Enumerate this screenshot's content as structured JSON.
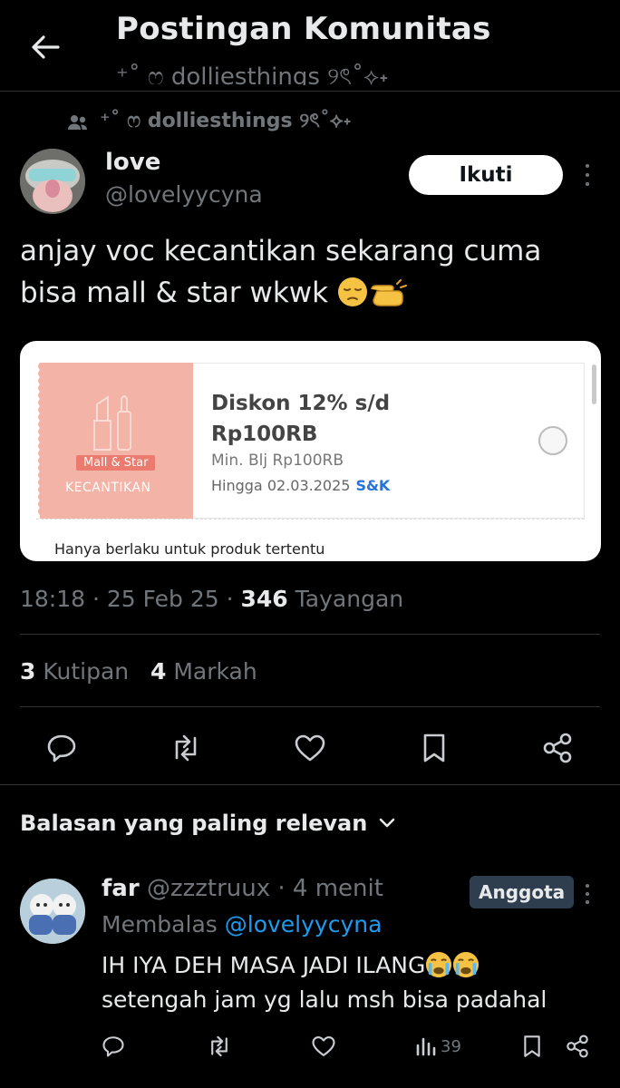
{
  "header": {
    "title": "Postingan Komunitas",
    "subtitle": "⁺˚ ෆ dolliesthings ୨ৎ˚⟡˖"
  },
  "community": {
    "name": "⁺˚ ෆ dolliesthings ୨ৎ˚⟡˖"
  },
  "post": {
    "author_name": "love",
    "author_handle": "@lovelyycyna",
    "follow_label": "Ikuti",
    "text_line1": "anjay voc kecantikan sekarang cuma",
    "text_line2": "bisa mall & star wkwk",
    "voucher": {
      "title_line1": "Diskon 12% s/d",
      "title_line2": "Rp100RB",
      "min_purchase": "Min. Blj Rp100RB",
      "valid_until": "Hingga 02.03.2025",
      "terms_link": "S&K",
      "badge": "Mall & Star",
      "category": "KECANTIKAN",
      "note": "Hanya berlaku untuk produk tertentu"
    },
    "time": "18:18",
    "date": "25 Feb 25",
    "views_count": "346",
    "views_label": "Tayangan",
    "quotes_count": "3",
    "quotes_label": "Kutipan",
    "bookmarks_count": "4",
    "bookmarks_label": "Markah"
  },
  "actions": {
    "icons": [
      "comment-icon",
      "repost-icon",
      "like-icon",
      "bookmark-icon",
      "share-icon"
    ]
  },
  "replies_sort": {
    "label": "Balasan yang paling relevan"
  },
  "reply": {
    "author_name": "far",
    "author_handle": "@zzztruux",
    "time": "4 menit",
    "badge": "Anggota",
    "replying_prefix": "Membalas",
    "replying_to": "@lovelyycyna",
    "text_line1": "IH IYA DEH MASA JADI ILANG",
    "text_line2": "setengah jam yg lalu msh bisa padahal",
    "views_count": "39"
  },
  "colors": {
    "background": "#000000",
    "text_primary": "#e7e9ea",
    "text_secondary": "#71767b",
    "accent_link": "#1d9bf0",
    "divider": "#2f3336",
    "member_badge_bg": "#2f3e4e"
  }
}
